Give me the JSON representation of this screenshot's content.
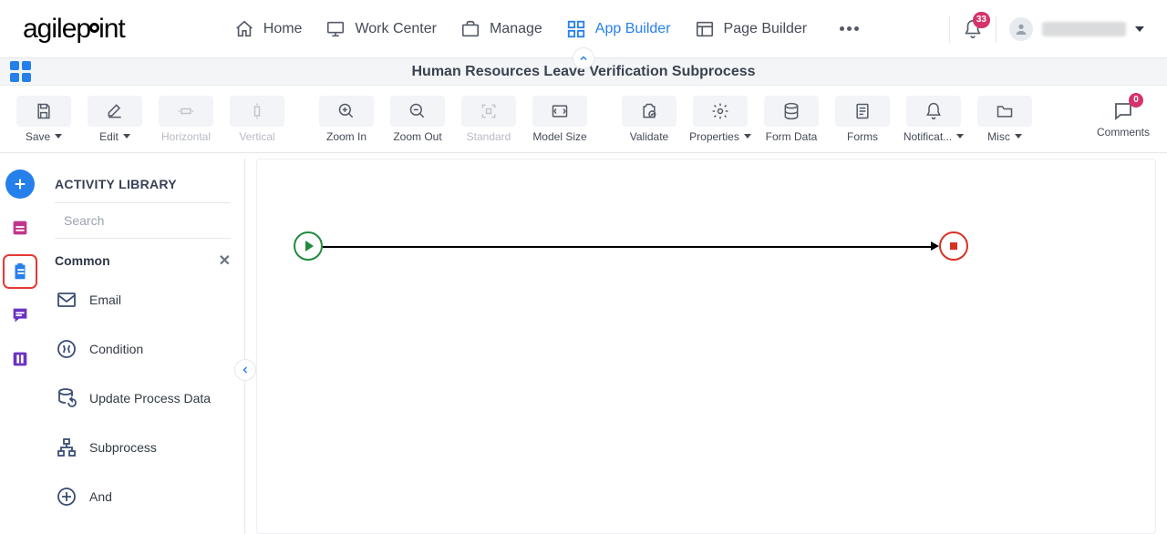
{
  "logo_parts": {
    "a": "agilep",
    "b": "int"
  },
  "nav": {
    "home": "Home",
    "work_center": "Work Center",
    "manage": "Manage",
    "app_builder": "App Builder",
    "page_builder": "Page Builder"
  },
  "notifications": {
    "count": "33"
  },
  "title": "Human Resources Leave Verification Subprocess",
  "toolbar": {
    "save": "Save",
    "edit": "Edit",
    "horizontal": "Horizontal",
    "vertical": "Vertical",
    "zoom_in": "Zoom In",
    "zoom_out": "Zoom Out",
    "standard": "Standard",
    "model_size": "Model Size",
    "validate": "Validate",
    "properties": "Properties",
    "form_data": "Form Data",
    "forms": "Forms",
    "notifications": "Notificat...",
    "misc": "Misc",
    "comments": "Comments",
    "comments_count": "0"
  },
  "library": {
    "title": "ACTIVITY LIBRARY",
    "search_placeholder": "Search",
    "category": "Common",
    "items": {
      "email": "Email",
      "condition": "Condition",
      "update": "Update Process Data",
      "subprocess": "Subprocess",
      "and": "And"
    }
  }
}
